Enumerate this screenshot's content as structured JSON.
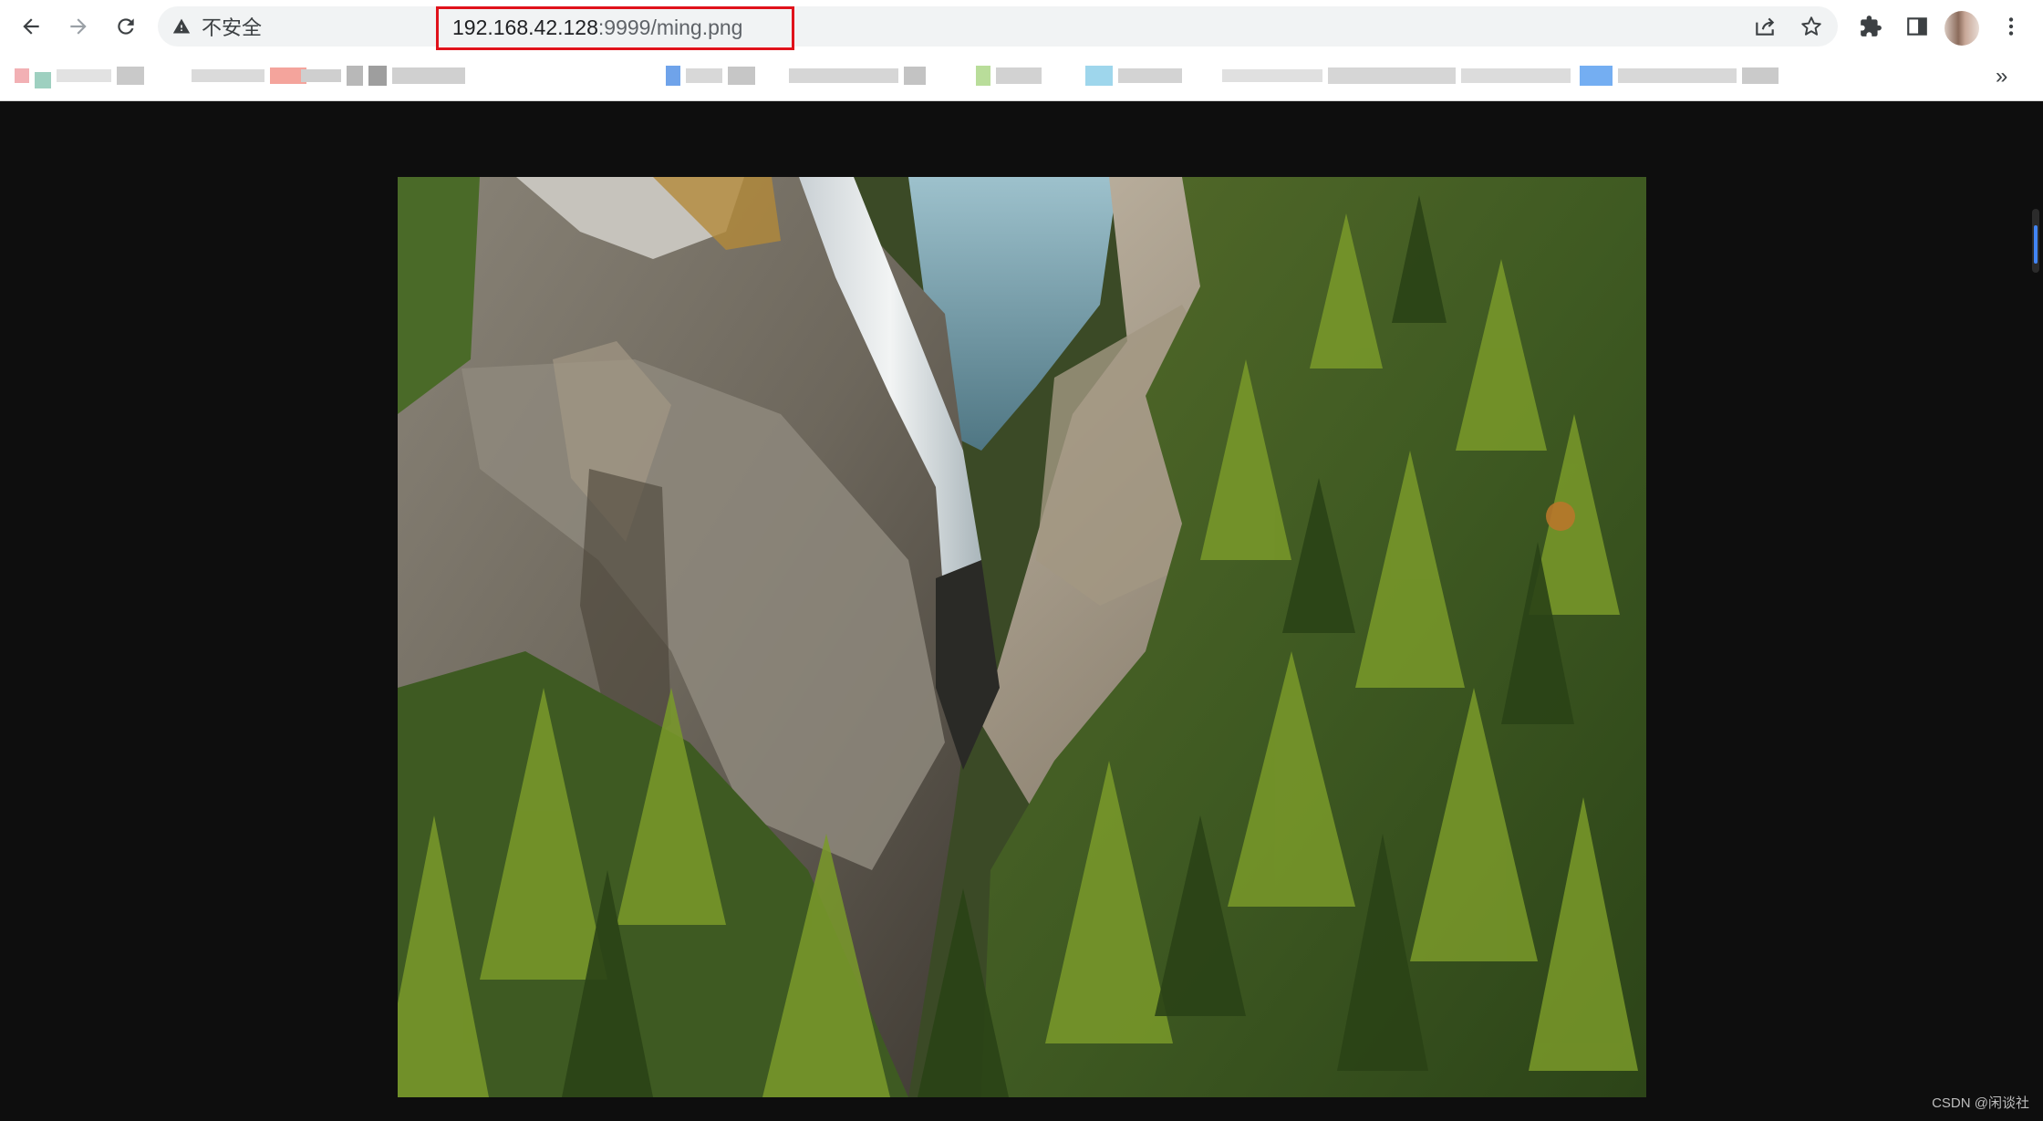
{
  "toolbar": {
    "back_icon": "arrow-left-icon",
    "forward_icon": "arrow-right-icon",
    "reload_icon": "reload-icon"
  },
  "omnibox": {
    "security_icon": "warning-triangle-icon",
    "security_label": "不安全",
    "url_host": "192.168.42.128",
    "url_rest": ":9999/ming.png",
    "highlight_color": "#e0121b"
  },
  "actions": {
    "share_icon": "share-icon",
    "bookmark_star_icon": "star-icon",
    "extensions_icon": "puzzle-icon",
    "side_panel_icon": "side-panel-icon",
    "profile_icon": "avatar",
    "menu_icon": "kebab-menu-icon"
  },
  "bookmarks_bar": {
    "overflow_label": "»"
  },
  "viewport": {
    "background_color": "#0e0e0e",
    "watermark": "CSDN @闲谈社"
  }
}
